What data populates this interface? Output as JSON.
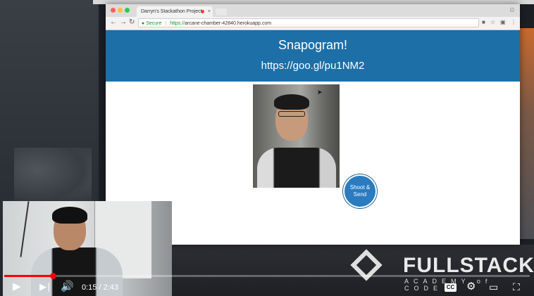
{
  "browser": {
    "tab_title": "Darryn's Stackathon Project",
    "tab_close": "×",
    "profile_icon": "person-icon",
    "secure_label": "Secure",
    "url": "https://arcane-chamber-42840.herokuapp.com",
    "url_scheme": "https://",
    "url_host": "arcane-chamber-42840.herokuapp.com"
  },
  "page": {
    "title": "Snapogram!",
    "link": "https://goo.gl/pu1NM2",
    "shoot_button": "Shoot & Send"
  },
  "logo": {
    "name": "FULLSTACK",
    "tagline": "ACADEMY of CODE"
  },
  "player": {
    "current_time": "0:15",
    "duration": "2:43",
    "time_display": "0:15 / 2:43",
    "progress_fraction": 0.092,
    "cc_label": "CC"
  },
  "icons": {
    "play": "play-icon",
    "next": "next-icon",
    "volume": "volume-icon",
    "settings": "gear-icon",
    "theater": "theater-icon",
    "fullscreen": "fullscreen-icon"
  },
  "colors": {
    "hero": "#1d6fa8",
    "button": "#2a7bc0",
    "progress": "#ff0000"
  }
}
